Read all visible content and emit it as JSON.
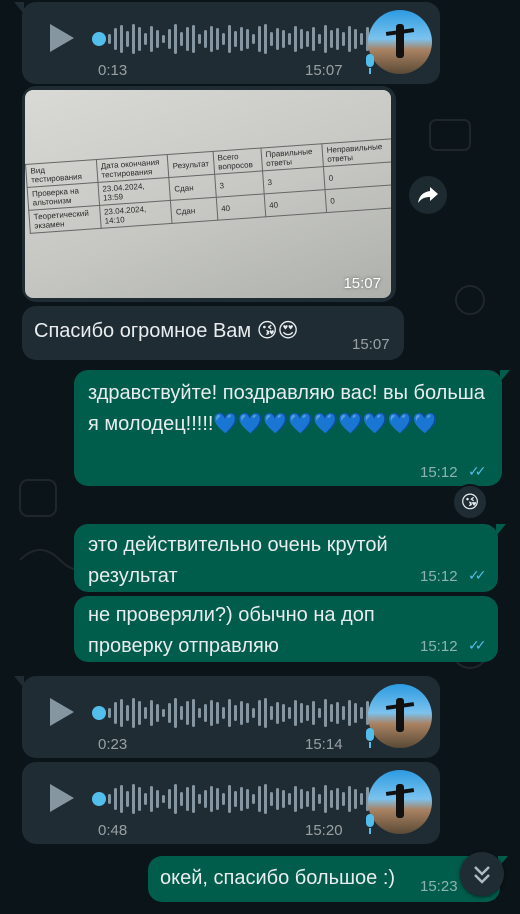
{
  "voice1": {
    "duration": "0:13",
    "time": "15:07"
  },
  "photo": {
    "time": "15:07",
    "headers": [
      "Вид тестирования",
      "Дата окончания тестирования",
      "Результат",
      "Всего вопросов",
      "Правильные ответы",
      "Неправильные ответы"
    ],
    "rows": [
      [
        "Проверка на альтонизм",
        "23.04.2024, 13:59",
        "Сдан",
        "3",
        "3",
        "0"
      ],
      [
        "Теоретический экзамен",
        "23.04.2024, 14:10",
        "Сдан",
        "40",
        "40",
        "0"
      ]
    ]
  },
  "msg_thanks": {
    "text": "Спасибо огромное Вам 😘😍",
    "time": "15:07"
  },
  "msg_congrats": {
    "text": "здравствуйте! поздравляю вас! вы большая молодец!!!!!💙💙💙💙💙💙💙💙💙",
    "time": "15:12",
    "reaction": "😘"
  },
  "msg_result": {
    "text": "это действительно очень крутой результат",
    "time": "15:12"
  },
  "msg_check": {
    "text": "не проверяли?) обычно на доп проверку отправляю",
    "time": "15:12"
  },
  "voice2": {
    "duration": "0:23",
    "time": "15:14"
  },
  "voice3": {
    "duration": "0:48",
    "time": "15:20"
  },
  "msg_ok": {
    "text": "окей, спасибо большое :)",
    "time": "15:23"
  },
  "colors": {
    "bg": "#0b1418",
    "incoming": "#1f2c33",
    "outgoing": "#005c4b",
    "accent": "#53bdeb"
  }
}
